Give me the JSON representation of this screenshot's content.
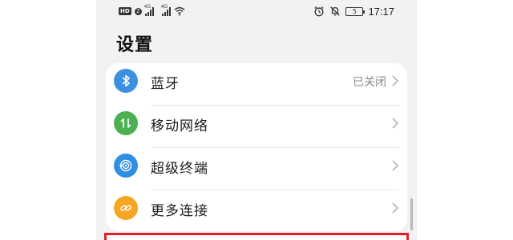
{
  "status_bar": {
    "hd_label": "HD",
    "sim_number": "2",
    "network_1": "4G",
    "network_2": "4G",
    "wifi_icon": "wifi-icon",
    "alarm_icon": "alarm-icon",
    "mute_icon": "mute-bell-icon",
    "battery_level": "5",
    "time": "17:17"
  },
  "page": {
    "title": "设置"
  },
  "settings": {
    "items": [
      {
        "label": "蓝牙",
        "value": "已关闭",
        "icon": "bluetooth-icon",
        "color": "#3d8fe0"
      },
      {
        "label": "移动网络",
        "value": "",
        "icon": "mobile-data-icon",
        "color": "#4caf50"
      },
      {
        "label": "超级终端",
        "value": "",
        "icon": "super-device-icon",
        "color": "#2f8fe3"
      },
      {
        "label": "更多连接",
        "value": "",
        "icon": "link-icon",
        "color": "#f5a623"
      }
    ]
  },
  "colors": {
    "background": "#f1f2f4",
    "card": "#ffffff",
    "highlight": "#e0202b"
  }
}
